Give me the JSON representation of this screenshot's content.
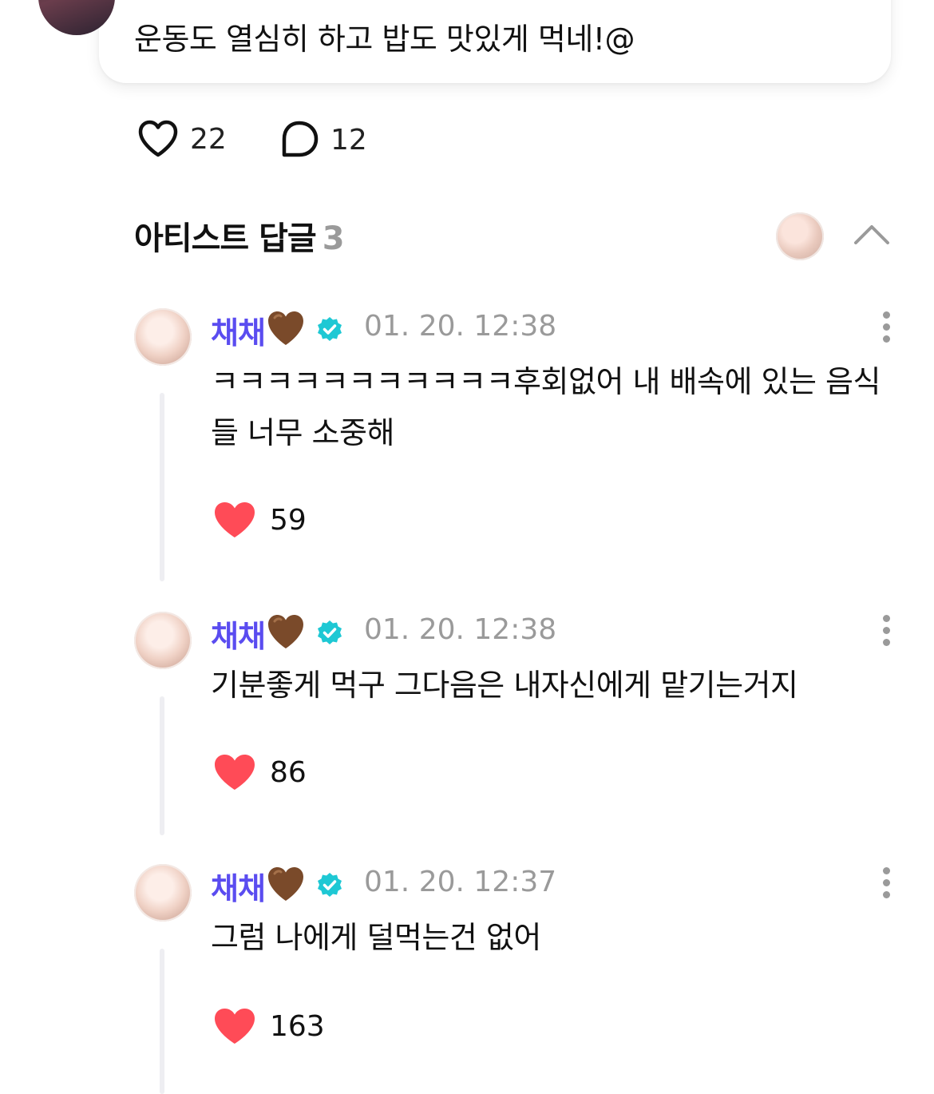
{
  "post": {
    "text": "운동도 열심히 하고 밥도 맛있게 먹네!@",
    "likes": "22",
    "comments": "12"
  },
  "section": {
    "title": "아티스트 답글",
    "count": "3"
  },
  "replies": [
    {
      "name": "채채",
      "time": "01. 20. 12:38",
      "text": "ㅋㅋㅋㅋㅋㅋㅋㅋㅋㅋㅋ후회없어 내 배속에 있는 음식들 너무 소중해",
      "likes": "59"
    },
    {
      "name": "채채",
      "time": "01. 20. 12:38",
      "text": "기분좋게 먹구 그다음은 내자신에게 맡기는거지",
      "likes": "86"
    },
    {
      "name": "채채",
      "time": "01. 20. 12:37",
      "text": "그럼 나에게 덜먹는건 없어",
      "likes": "163"
    }
  ],
  "colors": {
    "artist_name": "#5a4cf0",
    "like_heart": "#ff4b57",
    "verified": "#1ec8d4",
    "muted": "#9a9a9a"
  }
}
